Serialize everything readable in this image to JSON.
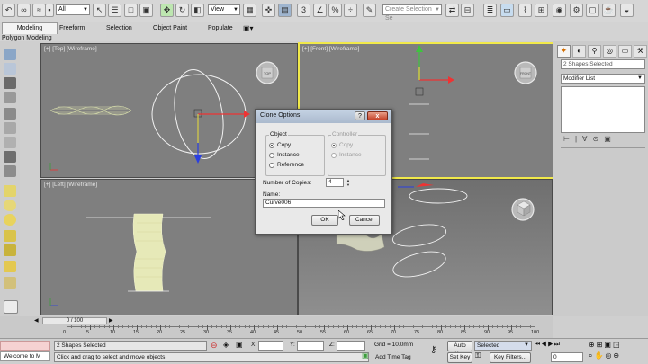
{
  "toolbar": {
    "selection_filter": "All",
    "ref_coord": "View",
    "named_selection_placeholder": "Create Selection Se"
  },
  "ribbon": {
    "tabs": [
      "Modeling",
      "Freeform",
      "Selection",
      "Object Paint",
      "Populate"
    ],
    "sub_label": "Polygon Modeling"
  },
  "viewports": {
    "top": "[+] [Top] [Wireframe]",
    "front": "[+] [Front] [Wireframe]",
    "left": "[+] [Left] [Wireframe]",
    "viewcube_top": "TOP",
    "viewcube_front": "FRONT"
  },
  "command_panel": {
    "selection_info": "2 Shapes Selected",
    "modifier_list": "Modifier List"
  },
  "dialog": {
    "title": "Clone Options",
    "help": "?",
    "close": "x",
    "object_group": "Object",
    "controller_group": "Controller",
    "object_options": [
      "Copy",
      "Instance",
      "Reference"
    ],
    "object_selected": 0,
    "controller_options": [
      "Copy",
      "Instance"
    ],
    "copies_label": "Number of Copies:",
    "copies_value": "4",
    "name_label": "Name:",
    "name_value": "Curve006",
    "ok": "OK",
    "cancel": "Cancel"
  },
  "timeline": {
    "frame_display": "0 / 100",
    "ticks": [
      "0",
      "5",
      "10",
      "15",
      "20",
      "25",
      "30",
      "35",
      "40",
      "45",
      "50",
      "55",
      "60",
      "65",
      "70",
      "75",
      "80",
      "85",
      "90",
      "95",
      "100"
    ]
  },
  "status": {
    "welcome": "Welcome to M",
    "selection": "2 Shapes Selected",
    "prompt": "Click and drag to select and move objects",
    "x_label": "X:",
    "y_label": "Y:",
    "z_label": "Z:",
    "grid": "Grid = 10.0mm",
    "add_time_tag": "Add Time Tag",
    "auto_key": "Auto Key",
    "set_key": "Set Key",
    "key_mode": "Selected",
    "key_filters": "Key Filters...",
    "frame": "0"
  }
}
